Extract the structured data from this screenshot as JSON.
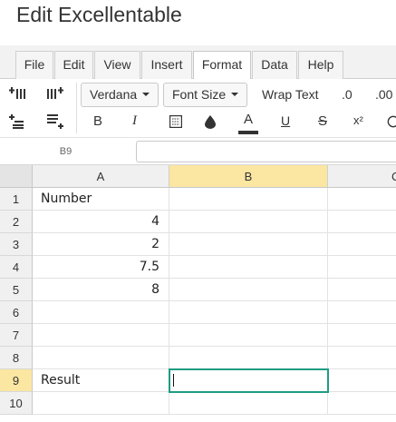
{
  "window": {
    "title": "Edit Excellentable"
  },
  "menu": {
    "tabs": [
      {
        "label": "File"
      },
      {
        "label": "Edit"
      },
      {
        "label": "View"
      },
      {
        "label": "Insert"
      },
      {
        "label": "Format",
        "active": true
      },
      {
        "label": "Data"
      },
      {
        "label": "Help"
      }
    ]
  },
  "toolbar": {
    "font_family": "Verdana",
    "font_size_label": "Font Size",
    "wrap_text_label": "Wrap Text",
    "decrease_decimal_label": ".0",
    "increase_decimal_label": ".00",
    "bold_label": "B",
    "italic_label": "I",
    "font_color_label": "A",
    "font_color_swatch": "#333333",
    "underline_label": "U",
    "strikethrough_label": "S",
    "superscript_label": "x²",
    "icons": [
      "insert-column-left-icon",
      "insert-column-right-icon",
      "insert-row-above-icon",
      "insert-row-below-icon",
      "borders-icon",
      "fill-color-icon",
      "currency-icon"
    ]
  },
  "formula_bar": {
    "cell_reference": "B9",
    "formula": ""
  },
  "grid": {
    "columns": [
      "A",
      "B",
      "C"
    ],
    "selected_column": "B",
    "rows": [
      "1",
      "2",
      "3",
      "4",
      "5",
      "6",
      "7",
      "8",
      "9",
      "10"
    ],
    "selected_row": "9",
    "cells": {
      "A1": "Number",
      "A2": "4",
      "A3": "2",
      "A4": "7.5",
      "A5": "8",
      "A9": "Result",
      "B9": ""
    },
    "active_cell": "B9",
    "colors": {
      "selection_header": "#fbe6a2",
      "active_cell_border": "#1f9c82"
    }
  }
}
